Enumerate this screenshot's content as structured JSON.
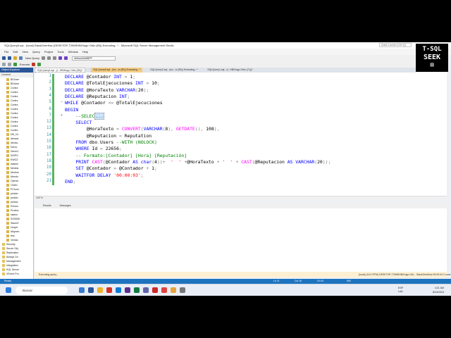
{
  "window": {
    "title": "SQLQuery5.sql - (local).StackOverflow (DESKTOP-T296SHB\\Hugo Ortiz (80)) Executing...* - Microsoft SQL Server Management Studio",
    "quick_launch": "Quick Launch (Ctrl+Q)"
  },
  "menu": [
    "File",
    "Edit",
    "View",
    "Query",
    "Project",
    "Tools",
    "Window",
    "Help"
  ],
  "toolbar": {
    "new_query": "New Query",
    "database": "dbMaxAfinBBPP",
    "execute": "Execute"
  },
  "logo": {
    "line1": "T-SQL",
    "line2": "SEEK"
  },
  "object_explorer": {
    "title": "Object Explorer",
    "connect": "Connect",
    "items": [
      "BDUser",
      "BDsAm",
      "Contra",
      "Contra",
      "Contra",
      "Contra",
      "Contra",
      "Contra",
      "Contra",
      "Contra",
      "Contra",
      "Contra",
      "Contra",
      "DB_Ce",
      "dbmaxi",
      "dbmsu",
      "Demo",
      "Demo1",
      "DISPO",
      "EWOZ",
      "dwtime",
      "Medine",
      "Medme",
      "Membr",
      "Operat",
      "Ordim",
      "PChurn",
      "pedido",
      "pedido",
      "pedido",
      "Person",
      "Prueba",
      "sistem",
      "SSISDB",
      "StackO",
      "Hospit",
      "Maymm",
      "test",
      "Ventas",
      "Security",
      "Server Obj",
      "Replication",
      "Always On",
      "Management",
      "Integration",
      "SQL Server",
      "XEvent Pro"
    ]
  },
  "tabs": [
    "SQLQuery4.sql - (l...HB\\Hugo Ortiz (55))*",
    "SQLQuery5.sql - (loc...ic (80)) Executing...*",
    "SQLQuery2.sql - (loc...ic (55)) Executing...*",
    "SQLQuery1.sql - (l...HB\\Hugo Ortiz (71))*"
  ],
  "code_lines": [
    {
      "n": "1",
      "html": "<span class='kw'>DECLARE</span> @Contador <span class='kw'>INT</span> <span class='gr'>=</span> 1<span class='gr'>;</span>"
    },
    {
      "n": "2",
      "html": "<span class='kw'>DECLARE</span> @TotalEjecuciones <span class='kw'>INT</span> <span class='gr'>=</span> 10<span class='gr'>;</span>"
    },
    {
      "n": "3",
      "html": "<span class='kw'>DECLARE</span> @HoraTexto <span class='kw'>VARCHAR</span><span class='gr'>(</span>20<span class='gr'>);</span>"
    },
    {
      "n": "4",
      "html": "<span class='kw'>DECLARE</span> @Reputacion <span class='kw'>INT</span><span class='gr'>;</span>"
    },
    {
      "n": "5",
      "html": "<span class='kw'>WHILE</span> @Contador <span class='gr'>&lt;=</span> @TotalEjecuciones"
    },
    {
      "n": "6",
      "html": "<span class='kw'>BEGIN</span>"
    },
    {
      "n": "7",
      "html": "    <span class='cm'>--SELEC<span class='sel'>...</span></span>"
    },
    {
      "n": "12",
      "html": "    <span class='kw'>SELECT</span>"
    },
    {
      "n": "13",
      "html": "        @HoraTexto <span class='gr'>=</span> <span class='fn'>CONVERT</span><span class='gr'>(</span><span class='kw'>VARCHAR</span><span class='gr'>(</span>8<span class='gr'>),</span> <span class='fn'>GETDATE</span><span class='gr'>(),</span> 108<span class='gr'>),</span>"
    },
    {
      "n": "14",
      "html": "        @Reputacion <span class='gr'>=</span> Reputation"
    },
    {
      "n": "15",
      "html": "    <span class='kw'>FROM</span> dbo<span class='gr'>.</span>Users <span class='cm'>--WITH (NOLOCK)</span>"
    },
    {
      "n": "16",
      "html": "    <span class='kw'>WHERE</span> Id <span class='gr'>=</span> 22656<span class='gr'>;</span>"
    },
    {
      "n": "17",
      "html": "    <span class='cm'>-- Formato:[Contador] [Hora] [Reputación]</span>"
    },
    {
      "n": "18",
      "html": "    <span class='kw'>PRINT</span> <span class='fn'>CAST</span><span class='gr'>(</span>@Contador <span class='kw'>AS</span> <span class='kw'>char</span><span class='gr'>(</span>4<span class='gr'>))+</span>  <span class='st'>'  '</span> <span class='gr'>+</span>@HoraTexto <span class='gr'>+</span> <span class='st'>'  '</span> <span class='gr'>+</span> <span class='fn'>CAST</span><span class='gr'>(</span>@Reputacion <span class='kw'>AS</span> <span class='kw'>VARCHAR</span><span class='gr'>(</span>20<span class='gr'>));</span>"
    },
    {
      "n": "19",
      "html": "    <span class='kw'>SET</span> @Contador <span class='gr'>=</span> @Contador <span class='gr'>+</span> 1<span class='gr'>;</span>"
    },
    {
      "n": "20",
      "html": "    <span class='kw'>WAITFOR</span> <span class='kw'>DELAY</span> <span class='st'>'00:00:03'</span><span class='gr'>;</span>"
    },
    {
      "n": "21",
      "html": "<span class='kw'>END</span><span class='gr'>;</span>"
    }
  ],
  "editor": {
    "zoom": "100 %"
  },
  "results": {
    "tab_results": "Results",
    "tab_messages": "Messages"
  },
  "query_status": {
    "left": "Executing query...",
    "right": "(local) (16.0 RTM)   DESKTOP-T296SHB\\Hugo Orti...   StackOverflow   00:00:04   0 rows"
  },
  "status_bar": {
    "ready": "Ready",
    "ln": "Ln 11",
    "col": "Col 16",
    "ch": "Ch 61",
    "ins": "INS"
  },
  "taskbar": {
    "search": "Buscar",
    "lang": "ESP LAA",
    "time": "4:21 AM",
    "date": "8/24/2024"
  }
}
